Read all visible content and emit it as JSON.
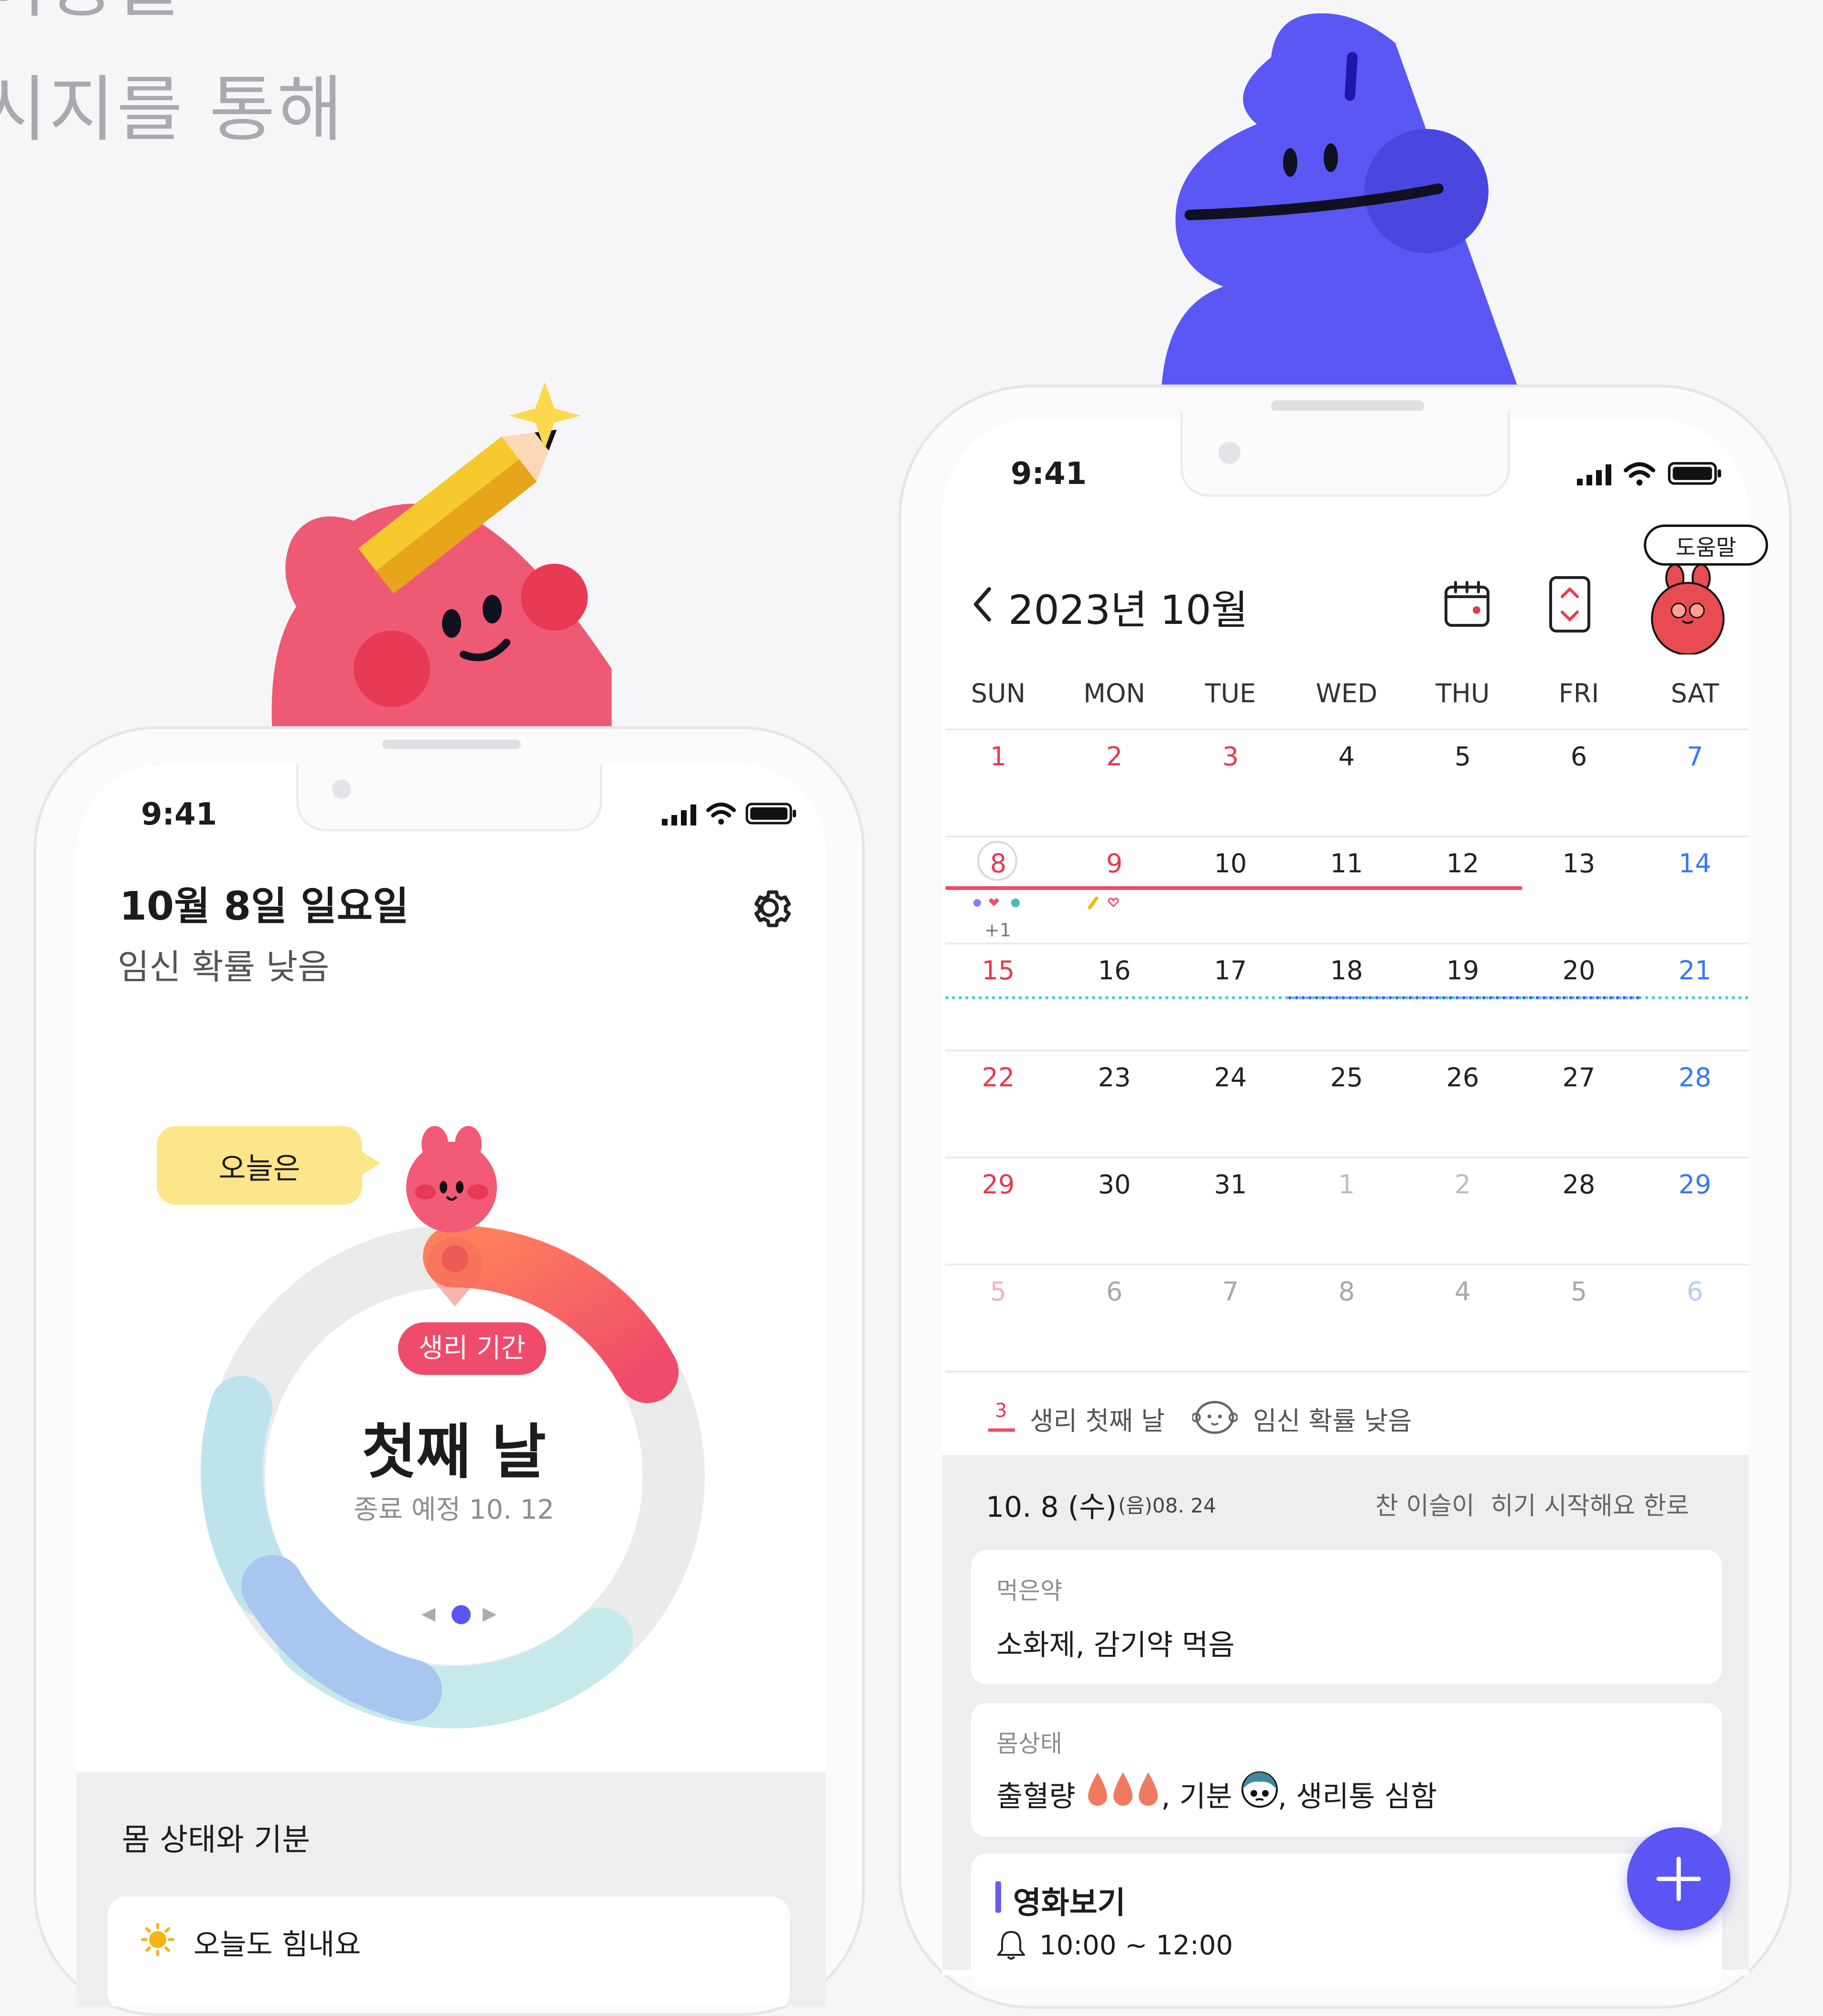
{
  "headline": {
    "line1": "이동을",
    "line2": "시지를 통해"
  },
  "left_phone": {
    "status": {
      "time": "9:41"
    },
    "header": {
      "date": "10월 8일 일요일",
      "subtitle": "임신 확률 낮음"
    },
    "speech_bubble": "오늘은",
    "cycle": {
      "tag": "생리 기간",
      "title": "첫째 날",
      "end_label": "종료 예정 10. 12",
      "period_fill": 0.22
    },
    "section_title": "몸 상태와 기분",
    "mood_item": "오늘도 힘내요"
  },
  "right_phone": {
    "status": {
      "time": "9:41"
    },
    "header": {
      "title": "2023년 10월",
      "help_badge": "도움말"
    },
    "weekdays": [
      "SUN",
      "MON",
      "TUE",
      "WED",
      "THU",
      "FRI",
      "SAT"
    ],
    "weeks": [
      [
        "1",
        "2",
        "3",
        "4",
        "5",
        "6",
        "7"
      ],
      [
        "8",
        "9",
        "10",
        "11",
        "12",
        "13",
        "14"
      ],
      [
        "15",
        "16",
        "17",
        "18",
        "19",
        "20",
        "21"
      ],
      [
        "22",
        "23",
        "24",
        "25",
        "26",
        "27",
        "28"
      ],
      [
        "29",
        "30",
        "31",
        "1",
        "2",
        "28",
        "29"
      ],
      [
        "5",
        "6",
        "7",
        "8",
        "4",
        "5",
        "6"
      ]
    ],
    "extra_count": "+1",
    "legend": {
      "count": "3",
      "period_label": "생리 첫째 날",
      "fertility_label": "임신 확률 낮음"
    },
    "detail": {
      "date": "10. 8 (수)",
      "lunar": "(음)08. 24",
      "solar_term": "찬 이슬이  히기 시작해요 한로"
    },
    "medicine": {
      "title": "먹은약",
      "value": "소화제, 감기약 먹음"
    },
    "body": {
      "title": "몸상태",
      "flow_label": "출혈량",
      "mood_label": ", 기분",
      "pain_label": ", 생리통 심함"
    },
    "event": {
      "title": "영화보기",
      "time": "10:00 ~ 12:00"
    }
  },
  "colors": {
    "accent": "#5a55f3",
    "period": "#ef4b6b",
    "sunday": "#e8384f",
    "saturday": "#3478f6",
    "fertile": "#3fd3dd"
  }
}
